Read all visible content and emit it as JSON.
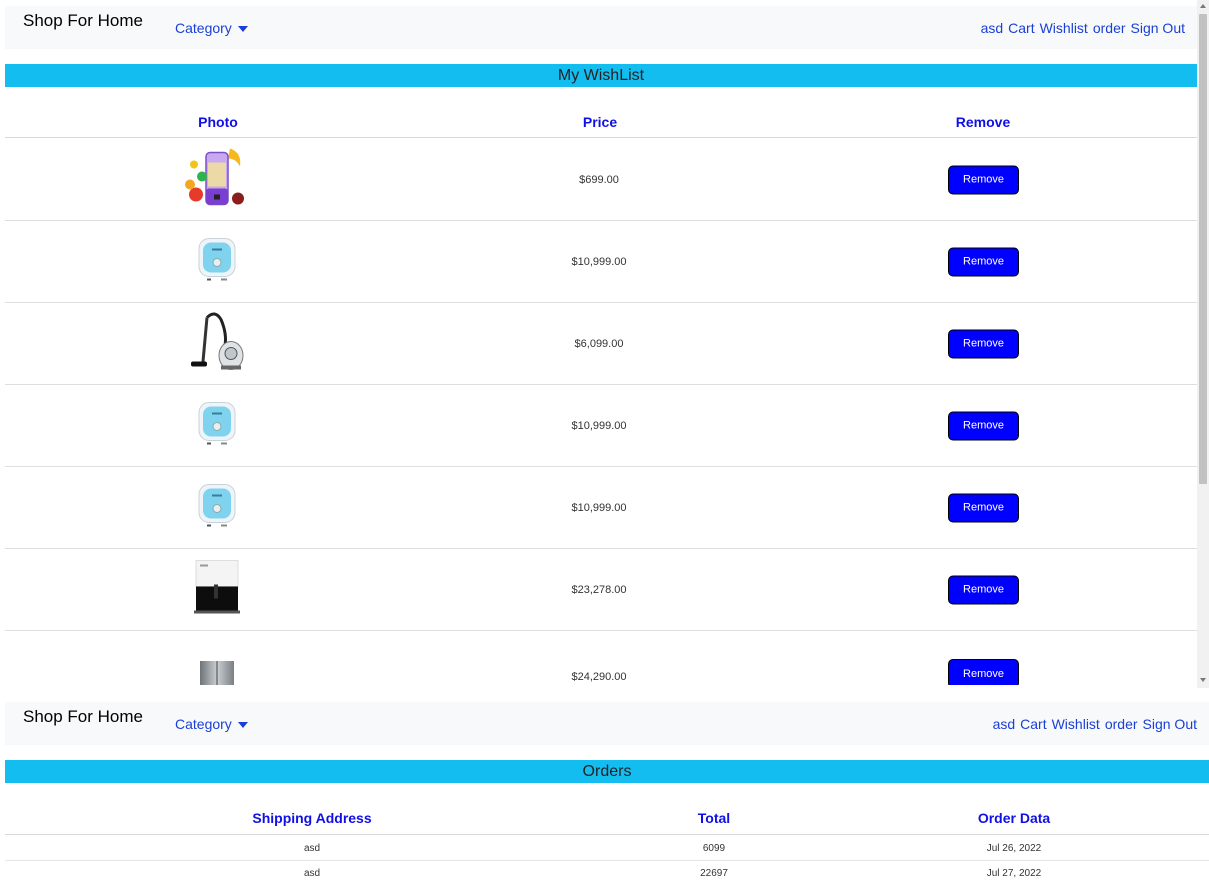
{
  "brand": "Shop For Home",
  "nav": {
    "category_label": "Category",
    "links": [
      "asd",
      "Cart",
      "Wishlist",
      "order",
      "Sign Out"
    ]
  },
  "wishlist": {
    "title": "My WishList",
    "headers": {
      "photo": "Photo",
      "price": "Price",
      "remove": "Remove"
    },
    "rows": [
      {
        "product_icon": "juicer-blender",
        "price": "$699.00",
        "remove_label": "Remove"
      },
      {
        "product_icon": "water-heater",
        "price": "$10,999.00",
        "remove_label": "Remove"
      },
      {
        "product_icon": "vacuum-cleaner",
        "price": "$6,099.00",
        "remove_label": "Remove"
      },
      {
        "product_icon": "water-heater",
        "price": "$10,999.00",
        "remove_label": "Remove"
      },
      {
        "product_icon": "water-heater",
        "price": "$10,999.00",
        "remove_label": "Remove"
      },
      {
        "product_icon": "water-purifier",
        "price": "$23,278.00",
        "remove_label": "Remove"
      },
      {
        "product_icon": "refrigerator",
        "price": "$24,290.00",
        "remove_label": "Remove"
      }
    ]
  },
  "orders": {
    "title": "Orders",
    "headers": {
      "address": "Shipping Address",
      "total": "Total",
      "date": "Order Data"
    },
    "rows": [
      {
        "address": "asd",
        "total": "6099",
        "date": "Jul 26, 2022"
      },
      {
        "address": "asd",
        "total": "22697",
        "date": "Jul 27, 2022"
      }
    ]
  },
  "colors": {
    "banner": "#13bdf0",
    "header_text": "#1010e6",
    "button": "#0000ff",
    "link": "#1a3fd6",
    "navbar_bg": "#f8f9fa"
  }
}
